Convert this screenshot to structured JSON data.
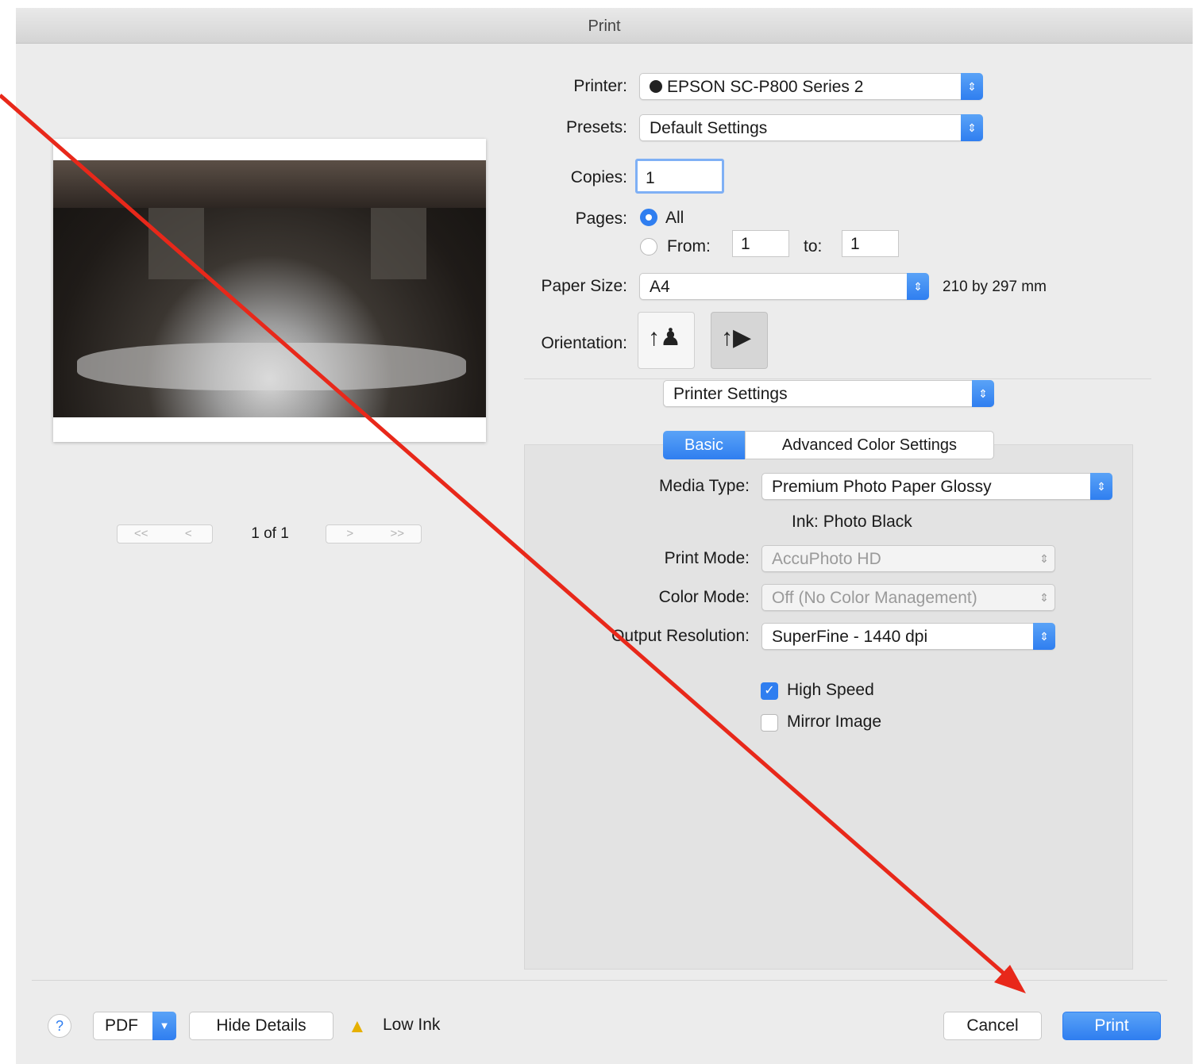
{
  "window": {
    "title": "Print"
  },
  "printer": {
    "label": "Printer:",
    "value": "EPSON SC-P800 Series 2"
  },
  "presets": {
    "label": "Presets:",
    "value": "Default Settings"
  },
  "copies": {
    "label": "Copies:",
    "value": "1"
  },
  "pages": {
    "label": "Pages:",
    "all_label": "All",
    "from_label": "From:",
    "from_value": "1",
    "to_label": "to:",
    "to_value": "1",
    "selected": "All"
  },
  "paper_size": {
    "label": "Paper Size:",
    "value": "A4",
    "dimensions": "210 by 297 mm"
  },
  "orientation": {
    "label": "Orientation:",
    "selected": "landscape"
  },
  "section": {
    "value": "Printer Settings"
  },
  "tabs": [
    {
      "label": "Basic",
      "active": true
    },
    {
      "label": "Advanced Color Settings",
      "active": false
    }
  ],
  "media_type": {
    "label": "Media Type:",
    "value": "Premium Photo Paper Glossy"
  },
  "ink": {
    "label": "Ink:",
    "value": "Photo Black"
  },
  "print_mode": {
    "label": "Print Mode:",
    "value": "AccuPhoto HD"
  },
  "color_mode": {
    "label": "Color Mode:",
    "value": "Off (No Color Management)"
  },
  "output_resolution": {
    "label": "Output Resolution:",
    "value": "SuperFine - 1440 dpi"
  },
  "high_speed": {
    "label": "High Speed",
    "checked": true
  },
  "mirror_image": {
    "label": "Mirror Image",
    "checked": false
  },
  "preview": {
    "page_indicator": "1 of 1",
    "first": "<<",
    "prev": "<",
    "next": ">",
    "last": ">>"
  },
  "footer": {
    "help": "?",
    "pdf": "PDF",
    "hide_details": "Hide Details",
    "low_ink": "Low Ink",
    "cancel": "Cancel",
    "print": "Print"
  },
  "colors": {
    "accent": "#2f7ef0",
    "annotation_arrow": "#e8281a",
    "dialog_bg": "#ececec",
    "panel_bg": "#e3e3e3"
  }
}
